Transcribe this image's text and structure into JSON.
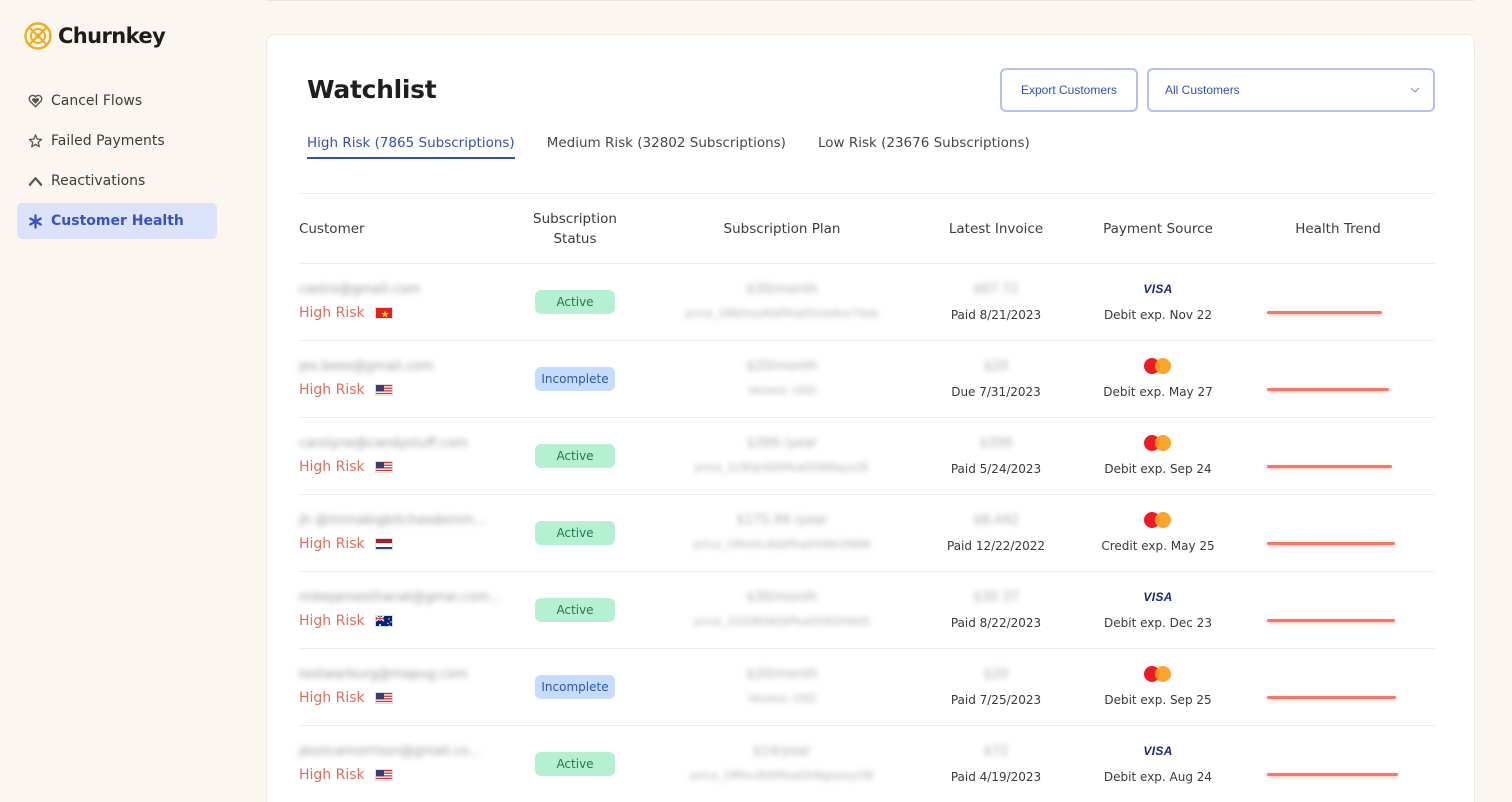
{
  "brand": {
    "name": "Churnkey"
  },
  "sidebar": {
    "items": [
      {
        "label": "Cancel Flows",
        "icon": "heart-icon",
        "active": false
      },
      {
        "label": "Failed Payments",
        "icon": "badge-star-icon",
        "active": false
      },
      {
        "label": "Reactivations",
        "icon": "arrow-up-icon",
        "active": false
      },
      {
        "label": "Customer Health",
        "icon": "asterisk-icon",
        "active": true
      }
    ]
  },
  "main": {
    "title": "Watchlist",
    "export_label": "Export Customers",
    "filter_value": "All Customers",
    "tabs": [
      {
        "label": "High Risk (7865 Subscriptions)",
        "active": true
      },
      {
        "label": "Medium Risk (32802 Subscriptions)",
        "active": false
      },
      {
        "label": "Low Risk (23676 Subscriptions)",
        "active": false
      }
    ],
    "columns": {
      "customer": "Customer",
      "status": "Subscription Status",
      "plan": "Subscription Plan",
      "invoice": "Latest Invoice",
      "payment": "Payment Source",
      "trend": "Health Trend"
    },
    "rows": [
      {
        "email": "castro@gmail.com",
        "risk": "High Risk",
        "flag": "vn",
        "status": "Active",
        "plan_price": "$30/month",
        "plan_id": "price_1Mk0xyAQtPkwDhnk4ocT4sb",
        "invoice_amount": "$67.72",
        "invoice_status": "Paid 8/21/2023",
        "card": "visa",
        "payment_text": "Debit exp. Nov 22",
        "health_trend": 0.9
      },
      {
        "email": "jes.bees@gmail.com",
        "risk": "High Risk",
        "flag": "us",
        "status": "Incomplete",
        "plan_price": "$20/month",
        "plan_id": "Vested: USD",
        "invoice_amount": "$20",
        "invoice_status": "Due 7/31/2023",
        "card": "mastercard",
        "payment_text": "Debit exp. May 27",
        "health_trend": 0.95
      },
      {
        "email": "carolyne@candystuff.com",
        "risk": "High Risk",
        "flag": "us",
        "status": "Active",
        "plan_price": "$399 /year",
        "plan_id": "price_1L9hJrAQtPkwDhN9ayo2E",
        "invoice_amount": "$399",
        "invoice_status": "Paid 5/24/2023",
        "card": "mastercard",
        "payment_text": "Debit exp. Sep 24",
        "health_trend": 0.98
      },
      {
        "email": "jh @immabigbitchasdemm...",
        "risk": "High Risk",
        "flag": "nl",
        "status": "Active",
        "plan_price": "$175.99 /year",
        "plan_id": "price_1MmhcAQtPkwDhNV2NN8",
        "invoice_amount": "$8,442",
        "invoice_status": "Paid 12/22/2022",
        "card": "mastercard",
        "payment_text": "Credit exp. May 25",
        "health_trend": 1.0
      },
      {
        "email": "mikejamesthanat@gmai.com...",
        "risk": "High Risk",
        "flag": "au",
        "status": "Active",
        "plan_price": "$30/month",
        "plan_id": "price_1O2l8HAQtPkwDhN2H4d5",
        "invoice_amount": "$30.37",
        "invoice_status": "Paid 8/22/2023",
        "card": "visa",
        "payment_text": "Debit exp. Dec 23",
        "health_trend": 1.0
      },
      {
        "email": "testwarburg@mapvg.com",
        "risk": "High Risk",
        "flag": "us",
        "status": "Incomplete",
        "plan_price": "$20/month",
        "plan_id": "Vested: USD",
        "invoice_amount": "$20",
        "invoice_status": "Paid 7/25/2023",
        "card": "mastercard",
        "payment_text": "Debit exp. Sep 25",
        "health_trend": 1.01
      },
      {
        "email": "jessicamorrison@gmail.co...",
        "risk": "High Risk",
        "flag": "us",
        "status": "Active",
        "plan_price": "$14/year",
        "plan_id": "price_1MfvcAQtPkwDhNgoyey2W",
        "invoice_amount": "$72",
        "invoice_status": "Paid 4/19/2023",
        "card": "visa",
        "payment_text": "Debit exp. Aug 24",
        "health_trend": 1.02
      }
    ]
  },
  "colors": {
    "accent": "#3250b8",
    "risk_high": "#e06d5a",
    "active_badge": "#b6f0d3",
    "incomplete_badge": "#c6dcfc",
    "trend_line": "#ef7a6a"
  }
}
